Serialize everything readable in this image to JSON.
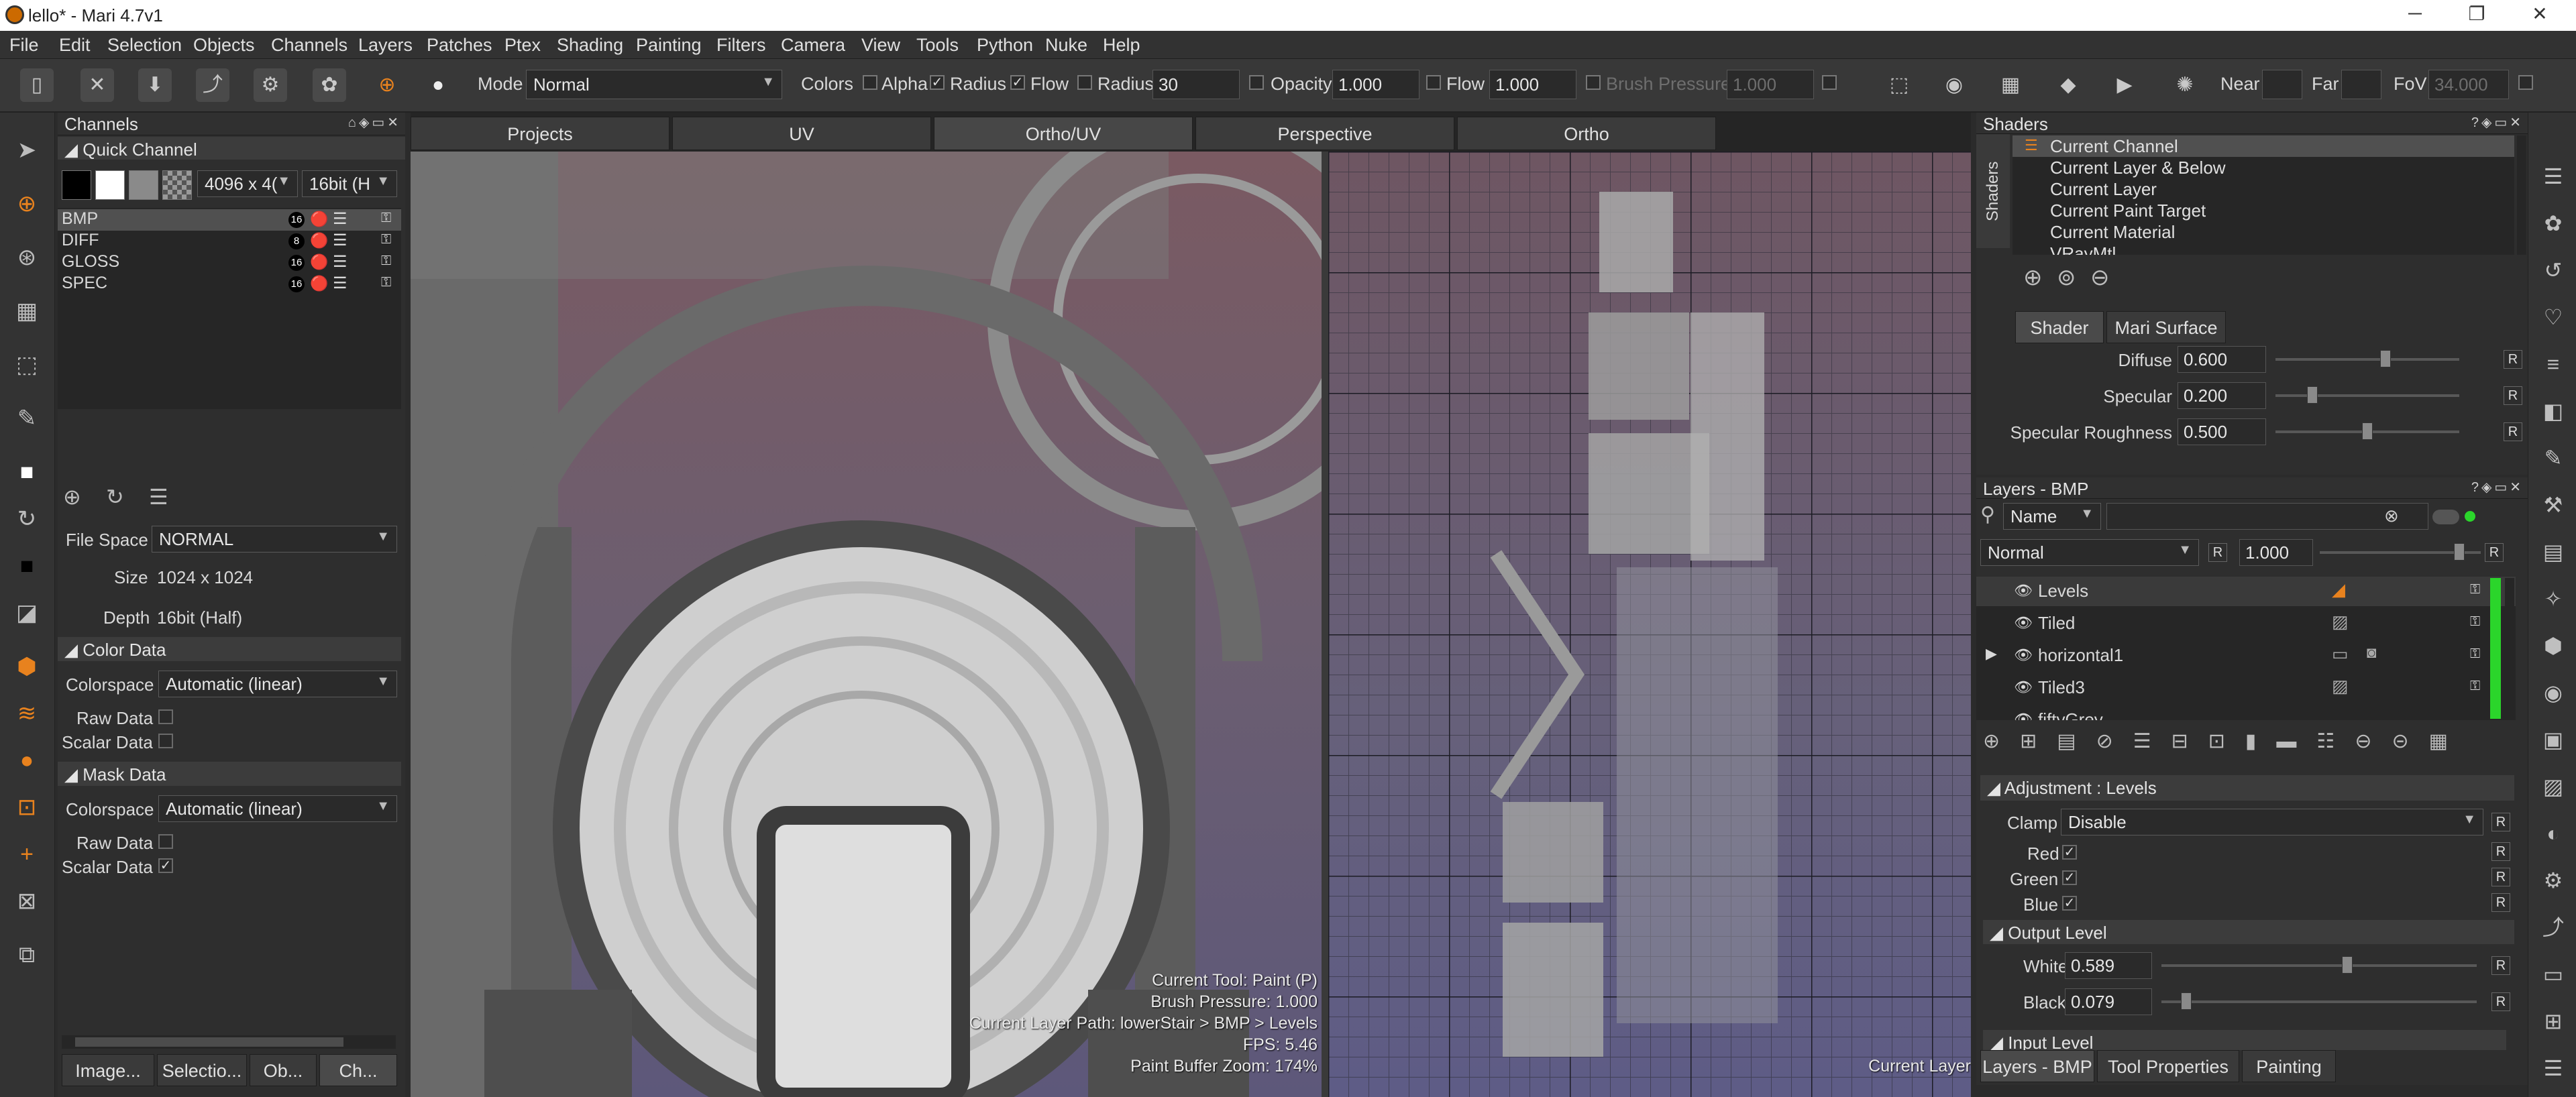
{
  "window": {
    "title": "lello* - Mari 4.7v1",
    "controls": {
      "minimize": "─",
      "maximize": "❐",
      "close": "✕"
    }
  },
  "menu": [
    "File",
    "Edit",
    "Selection",
    "Objects",
    "Channels",
    "Layers",
    "Patches",
    "Ptex",
    "Shading",
    "Painting",
    "Filters",
    "Camera",
    "View",
    "Tools",
    "Python",
    "Nuke",
    "Help"
  ],
  "toolbar": {
    "mode_label": "Mode",
    "mode_value": "Normal",
    "colors_label": "Colors",
    "alpha_label": "Alpha",
    "radius_label": "Radius",
    "flow_label": "Flow",
    "radius2_label": "Radius",
    "radius2_value": "30",
    "opacity_label": "Opacity",
    "opacity_value": "1.000",
    "flow2_label": "Flow",
    "flow2_value": "1.000",
    "brush_pressure_label": "Brush Pressure",
    "brush_pressure_value": "1.000",
    "near_label": "Near",
    "far_label": "Far",
    "fov_label": "FoV",
    "fov_value": "34.000"
  },
  "channels": {
    "panel_title": "Channels",
    "quick_channel_label": "Quick Channel",
    "size_dropdown": "4096 x 4(",
    "depth_dropdown": "16bit (H",
    "list": [
      {
        "name": "BMP",
        "bits": "16"
      },
      {
        "name": "DIFF",
        "bits": "8"
      },
      {
        "name": "GLOSS",
        "bits": "16"
      },
      {
        "name": "SPEC",
        "bits": "16"
      }
    ],
    "file_space_label": "File Space",
    "file_space_value": "NORMAL",
    "size_label": "Size",
    "size_value": "1024 x 1024",
    "depth_label": "Depth",
    "depth_value": "16bit (Half)",
    "color_data": {
      "header": "Color Data",
      "colorspace_label": "Colorspace",
      "colorspace_value": "Automatic (linear)",
      "raw_label": "Raw Data",
      "scalar_label": "Scalar Data"
    },
    "mask_data": {
      "header": "Mask Data",
      "colorspace_label": "Colorspace",
      "colorspace_value": "Automatic (linear)",
      "raw_label": "Raw Data",
      "scalar_label": "Scalar Data"
    },
    "bottom_tabs": [
      "Image...",
      "Selectio...",
      "Ob...",
      "Ch..."
    ]
  },
  "viewport": {
    "tabs": [
      "Projects",
      "UV",
      "Ortho/UV",
      "Perspective",
      "Ortho"
    ],
    "active_tab": "Ortho/UV",
    "hud": {
      "tool": "Current Tool: Paint (P)",
      "pressure": "Brush Pressure: 1.000",
      "layer_path": "Current Layer Path: lowerStair > BMP > Levels",
      "fps": "FPS: 5.46",
      "zoom": "Paint Buffer Zoom: 174%"
    },
    "right_hud": "Current Layer"
  },
  "shaders": {
    "panel_title": "Shaders",
    "side_label": "Shaders",
    "list": [
      "Current Channel",
      "Current Layer & Below",
      "Current Layer",
      "Current Paint Target",
      "Current Material",
      "VRayMtl"
    ],
    "tabs": [
      "Shader",
      "Mari Surface"
    ],
    "params": [
      {
        "label": "Diffuse",
        "value": "0.600",
        "level": 0.6
      },
      {
        "label": "Specular",
        "value": "0.200",
        "level": 0.2
      },
      {
        "label": "Specular Roughness",
        "value": "0.500",
        "level": 0.5
      }
    ],
    "reset_label": "R"
  },
  "layers": {
    "panel_title": "Layers - BMP",
    "filter_mode": "Name",
    "blend_mode": "Normal",
    "blend_r": "R",
    "opacity_value": "1.000",
    "list": [
      "Levels",
      "Tiled",
      "horizontal1",
      "Tiled3",
      "fiftyGrey"
    ],
    "adjustment_header": "Adjustment : Levels",
    "clamp_label": "Clamp",
    "clamp_value": "Disable",
    "red_label": "Red",
    "green_label": "Green",
    "blue_label": "Blue",
    "output_level_header": "Output Level",
    "white_label": "White",
    "white_value": "0.589",
    "white_level": 0.589,
    "black_label": "Black",
    "black_value": "0.079",
    "black_level": 0.079,
    "input_level_header": "Input Level",
    "bottom_tabs": [
      "Layers - BMP",
      "Tool Properties",
      "Painting"
    ]
  },
  "colors": {
    "accent_orange": "#e8821e",
    "active_green": "#2bd52b"
  }
}
